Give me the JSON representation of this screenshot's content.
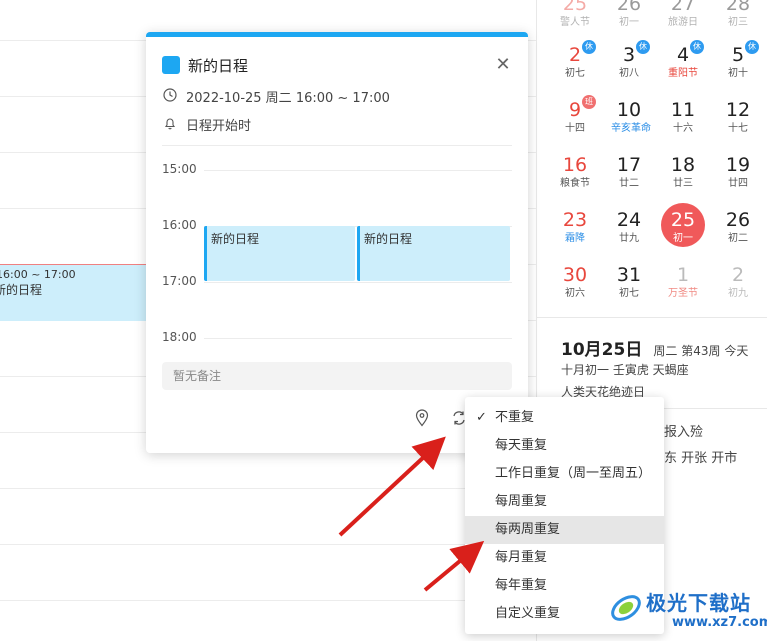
{
  "background_event": {
    "time": "16:00 ~ 17:00",
    "title": "新的日程"
  },
  "mini_calendar": {
    "rows": [
      [
        {
          "day": "25",
          "lunar": "警人节",
          "style": "red-faded"
        },
        {
          "day": "26",
          "lunar": "初一",
          "style": "faded"
        },
        {
          "day": "27",
          "lunar": "旅游日",
          "style": "faded"
        },
        {
          "day": "28",
          "lunar": "初三",
          "style": "faded"
        }
      ],
      [
        {
          "day": "2",
          "lunar": "初七",
          "red": true,
          "badge": "休",
          "badge_color": "blue"
        },
        {
          "day": "3",
          "lunar": "初八",
          "badge": "休",
          "badge_color": "blue"
        },
        {
          "day": "4",
          "lunar": "重阳节",
          "lunar_color": "red",
          "badge": "休",
          "badge_color": "blue"
        },
        {
          "day": "5",
          "lunar": "初十",
          "badge": "休",
          "badge_color": "blue"
        }
      ],
      [
        {
          "day": "9",
          "lunar": "十四",
          "red": true,
          "badge": "班",
          "badge_color": "red"
        },
        {
          "day": "10",
          "lunar": "辛亥革命",
          "lunar_color": "blue"
        },
        {
          "day": "11",
          "lunar": "十六"
        },
        {
          "day": "12",
          "lunar": "十七"
        }
      ],
      [
        {
          "day": "16",
          "lunar": "粮食节",
          "red": true
        },
        {
          "day": "17",
          "lunar": "廿二"
        },
        {
          "day": "18",
          "lunar": "廿三"
        },
        {
          "day": "19",
          "lunar": "廿四"
        }
      ],
      [
        {
          "day": "23",
          "lunar": "霜降",
          "red": true,
          "lunar_color": "blue"
        },
        {
          "day": "24",
          "lunar": "廿九"
        },
        {
          "day": "25",
          "lunar": "初一",
          "today": true
        },
        {
          "day": "26",
          "lunar": "初二"
        }
      ],
      [
        {
          "day": "30",
          "lunar": "初六",
          "red": true
        },
        {
          "day": "31",
          "lunar": "初七"
        },
        {
          "day": "1",
          "lunar": "万圣节",
          "gray": true,
          "lunar_color": "fest-red"
        },
        {
          "day": "2",
          "lunar": "初九",
          "gray": true
        }
      ]
    ],
    "date_title": "10月25日",
    "date_sub": "周二 第43周 今天",
    "lunar_line": "十月初一 壬寅虎 天蝎座",
    "festival_line": "人类天花绝迹日",
    "yi_line_1": "报入殓",
    "yi_line_2": "东 开张 开市"
  },
  "popup": {
    "title": "新的日程",
    "time": "2022-10-25 周二 16:00 ~ 17:00",
    "reminder": "日程开始时",
    "hours": [
      "15:00",
      "16:00",
      "17:00",
      "18:00"
    ],
    "events": [
      "新的日程",
      "新的日程"
    ],
    "note_placeholder": "暂无备注",
    "accent": "#1da7f2"
  },
  "repeat_menu": {
    "selected": "不重复",
    "items": [
      "不重复",
      "每天重复",
      "工作日重复（周一至周五）",
      "每周重复",
      "每两周重复",
      "每月重复",
      "每年重复",
      "自定义重复"
    ],
    "hovered": "每两周重复"
  },
  "watermark": {
    "title": "极光下载站",
    "url": "www.xz7.com"
  }
}
